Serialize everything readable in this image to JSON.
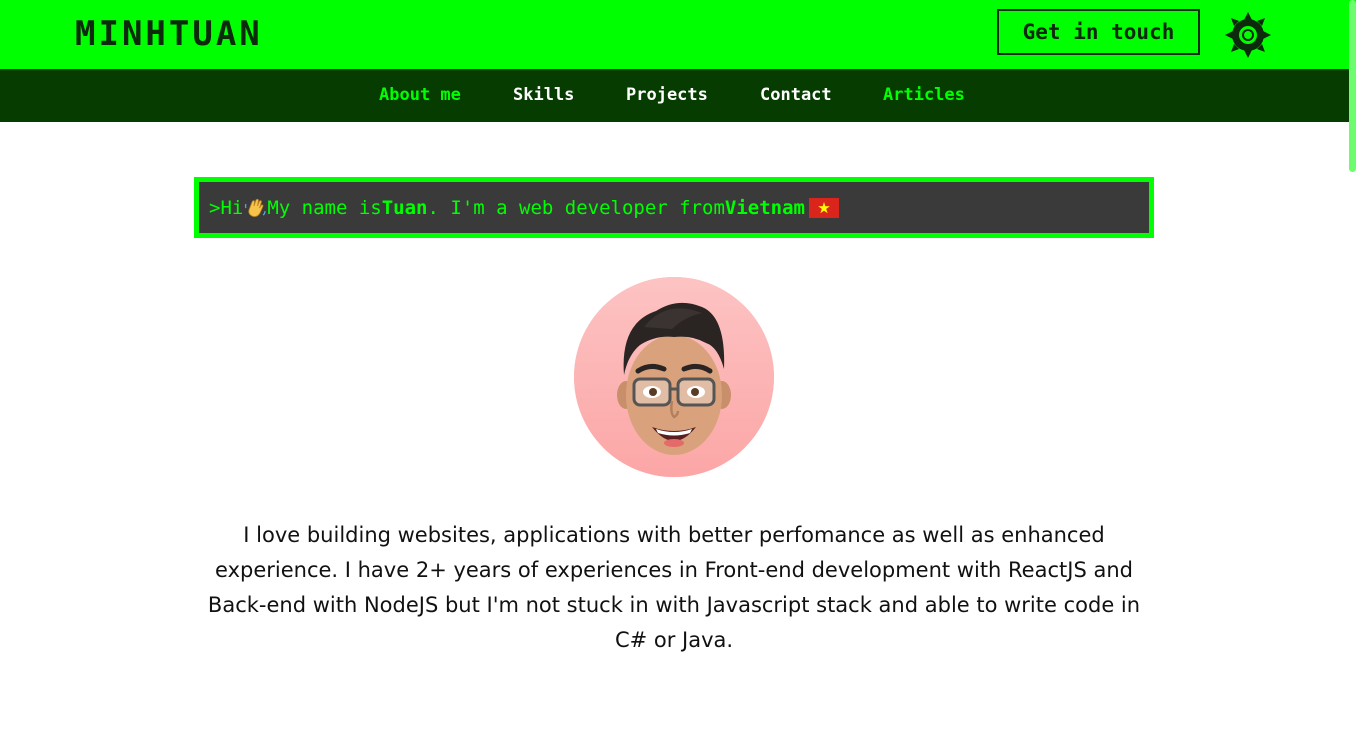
{
  "header": {
    "logo_text": "MINHTUAN",
    "cta_label": "Get in touch",
    "theme_toggle_icon": "sun-gear-icon"
  },
  "nav": {
    "items": [
      {
        "label": "About me",
        "active": true
      },
      {
        "label": "Skills",
        "active": false
      },
      {
        "label": "Projects",
        "active": false
      },
      {
        "label": "Contact",
        "active": false
      },
      {
        "label": "Articles",
        "active": true
      }
    ]
  },
  "intro": {
    "prompt": ">",
    "greeting": "Hi",
    "wave_icon": "waving-hand-icon",
    "name_prefix": "My name is",
    "name": "Tuan",
    "middle": ". I'm a web developer from",
    "country": "Vietnam",
    "flag_icon": "vietnam-flag-icon"
  },
  "avatar": {
    "icon": "memoji-avatar"
  },
  "bio": {
    "text": "I love building websites, applications with better perfomance as well as enhanced experience. I have 2+ years of experiences in Front-end development with ReactJS and Back-end with NodeJS but I'm not stuck in with Javascript stack and able to write code in C# or Java."
  },
  "colors": {
    "accent": "#00ff00",
    "nav_bg": "#063c00",
    "terminal_bg": "#3a3a3a",
    "avatar_bg": "#fdb8b8"
  }
}
